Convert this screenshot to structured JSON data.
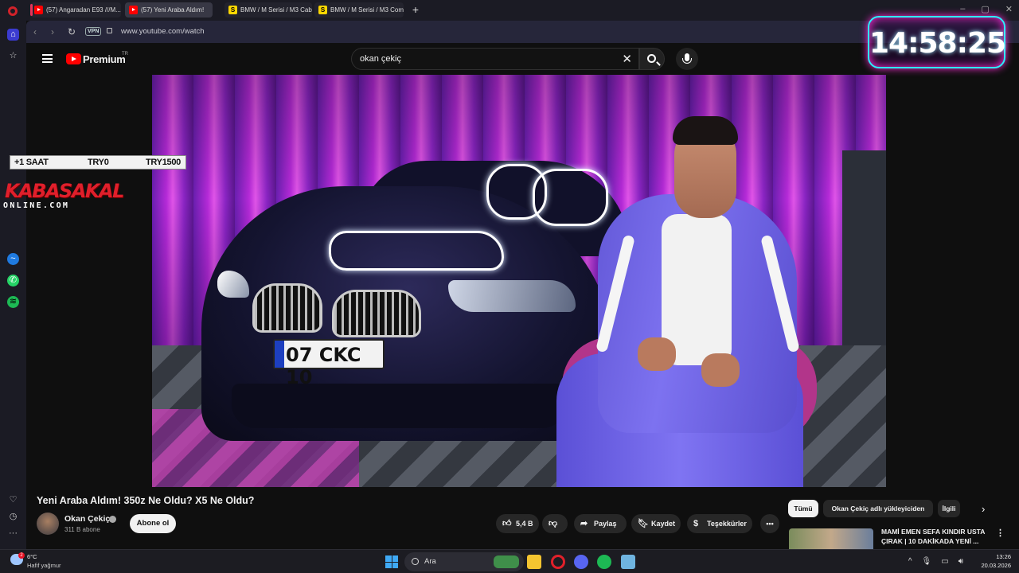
{
  "browser": {
    "tabs": [
      {
        "title": "(57) Angaradan E93 ///M...",
        "icon": "youtube-icon"
      },
      {
        "title": "(57) Yeni Araba Aldım!",
        "icon": "youtube-icon"
      },
      {
        "title": "BMW / M Serisi / M3 Cab...",
        "icon": "s-site-icon"
      },
      {
        "title": "BMW / M Serisi / M3 Com...",
        "icon": "s-site-icon"
      }
    ],
    "active_tab_index": 1,
    "vpn_label": "VPN",
    "url": "www.youtube.com/watch"
  },
  "overlay": {
    "clock": "14:58:25",
    "stream_bar": {
      "left": "+1 SAAT",
      "mid": "TRY0",
      "right": "TRY1500"
    },
    "brand_main": "KABASAKAL",
    "brand_sub": "ONLINE.COM"
  },
  "youtube": {
    "logo_text": "Premium",
    "region": "TR",
    "search_value": "okan çekiç",
    "video": {
      "title": "Yeni Araba Aldım! 350z Ne Oldu? X5 Ne Oldu?",
      "plate_text": "07 CKC 10",
      "channel": "Okan Çekiç",
      "subscribers": "311 B abone",
      "subscribe_label": "Abone ol",
      "likes": "5,4 B",
      "share_label": "Paylaş",
      "save_label": "Kaydet",
      "thanks_label": "Teşekkürler"
    },
    "chips": [
      "Tümü",
      "Okan Çekiç adlı yükleyiciden",
      "İlgili"
    ],
    "recommendation": {
      "title": "MAMİ EMEN SEFA KINDIR USTA ÇIRAK | 10 DAKİKADA YENİ ..."
    }
  },
  "taskbar": {
    "weather_temp": "6°C",
    "weather_desc": "Hafif yağmur",
    "weather_badge": "2",
    "search_label": "Ara",
    "time": "13:26",
    "date": "20.03.2026"
  },
  "colors": {
    "youtube_red": "#ff0000",
    "neon_cyan": "#2ef0ff",
    "neon_pink": "#ff2bd6",
    "brand_red": "#e01f2b"
  }
}
